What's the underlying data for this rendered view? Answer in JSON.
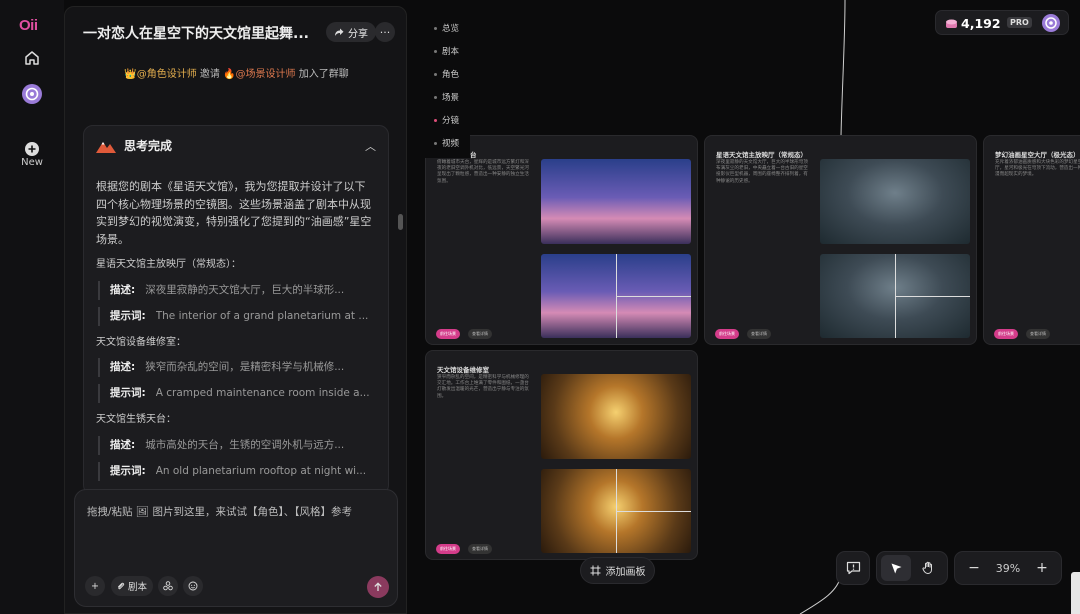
{
  "rail": {
    "logo": "Oii",
    "new_label": "New"
  },
  "chat": {
    "title": "一对恋人在星空下的天文馆里起舞...",
    "share_label": "分享",
    "more_label": "···",
    "invite": {
      "user1": "@角色设计师",
      "mid": " 邀请 ",
      "user2": "@场景设计师",
      "end": " 加入了群聊"
    },
    "thinking": {
      "title": "思考完成",
      "intro": "根据您的剧本《星语天文馆》，我为您提取并设计了以下四个核心物理场景的空镜图。这些场景涵盖了剧本中从现实到梦幻的视觉演变，特别强化了您提到的“油画感”星空场景。",
      "sections": [
        {
          "name": "星语天文馆主放映厅（常规态）：",
          "desc_label": "描述:",
          "desc": "深夜里寂静的天文馆大厅，巨大的半球形...",
          "prompt_label": "提示词:",
          "prompt": "The interior of a grand planetarium at ..."
        },
        {
          "name": "天文馆设备维修室：",
          "desc_label": "描述:",
          "desc": "狭窄而杂乱的空间，是精密科学与机械修...",
          "prompt_label": "提示词:",
          "prompt": "A cramped maintenance room inside a..."
        },
        {
          "name": "天文馆生锈天台：",
          "desc_label": "描述:",
          "desc": "城市高处的天台，生锈的空调外机与远方...",
          "prompt_label": "提示词:",
          "prompt": "An old planetarium rooftop at night wi..."
        }
      ]
    },
    "input": {
      "placeholder": "拖拽/粘贴 🖼 图片到这里，来试试【角色】、【风格】参考",
      "script_label": "剧本"
    }
  },
  "canvas_nav": {
    "items": [
      "总览",
      "剧本",
      "角色",
      "场景",
      "分镜",
      "视频"
    ]
  },
  "cards": [
    {
      "title": "台",
      "desc": "俯瞰着城市天台，星辉的是城市远方繁灯和深夜的老旧空调外机对比，低远景，天空繁光河呈现出了颗粒感，营造出一种安静的独立生活氛围。",
      "scene": "rooftop"
    },
    {
      "title": "星语天文馆主放映厅（常规态）",
      "desc": "深夜里寂静的天文馆大厅，巨大的半球形穹顶布满灰尘的老旧，中央矗立着一台古旧的星空投影仪巨型机器，周围的座椅整齐排列着，有种静谧的历史感。",
      "scene": "hall"
    },
    {
      "title": "梦幻油画星空大厅（极光态）",
      "desc": "充斥着浓郁油画质感和大块色彩的梦幻星空大厅，星河和极光在穹顶下流动，营造出一种浪漫而超现实的梦境。",
      "scene": "dream"
    },
    {
      "title": "天文馆设备维修室",
      "desc": "狭窄而杂乱的空间，是精密科学与机械修理的交汇地。工作台上堆满了零件和图纸，一盏台灯散发出温暖的光芒，营造出宁静与专注的氛围。",
      "scene": "room"
    }
  ],
  "card_tags": {
    "primary": "前往场景",
    "secondary": "查看详情"
  },
  "canvas": {
    "add_panel_label": "添加画板",
    "zoom": "39%",
    "credits": "4,192",
    "plan": "PRO"
  }
}
